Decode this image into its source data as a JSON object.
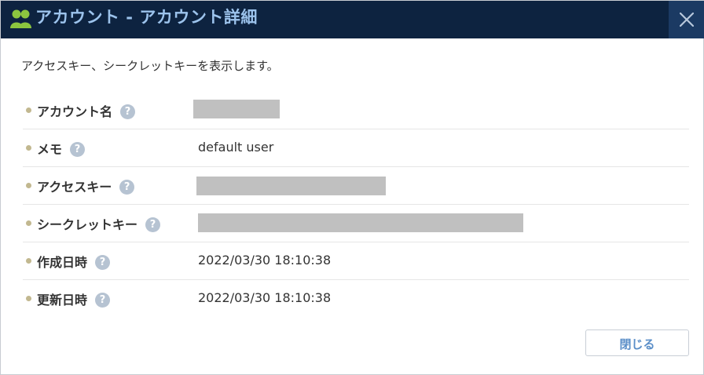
{
  "window": {
    "title": "アカウント - アカウント詳細",
    "title_icon": "users-icon",
    "close_icon": "close-icon"
  },
  "description": "アクセスキー、シークレットキーを表示します。",
  "help_glyph": "?",
  "fields": [
    {
      "key": "account_name",
      "label": "アカウント名",
      "value": "",
      "redacted": true
    },
    {
      "key": "memo",
      "label": "メモ",
      "value": "default user",
      "redacted": false
    },
    {
      "key": "access_key",
      "label": "アクセスキー",
      "value": "",
      "redacted": true
    },
    {
      "key": "secret_key",
      "label": "シークレットキー",
      "value": "",
      "redacted": true
    },
    {
      "key": "created_at",
      "label": "作成日時",
      "value": "2022/03/30 18:10:38",
      "redacted": false
    },
    {
      "key": "updated_at",
      "label": "更新日時",
      "value": "2022/03/30 18:10:38",
      "redacted": false
    }
  ],
  "footer": {
    "close_label": "閉じる"
  },
  "colors": {
    "titlebar": "#0d2340",
    "title_text": "#9cc3ec",
    "icon_green": "#8cc63f",
    "help_icon": "#b6c3d2",
    "bullet": "#c2b890",
    "redaction": "#c0c0c0",
    "button_text": "#5a8ec8"
  }
}
